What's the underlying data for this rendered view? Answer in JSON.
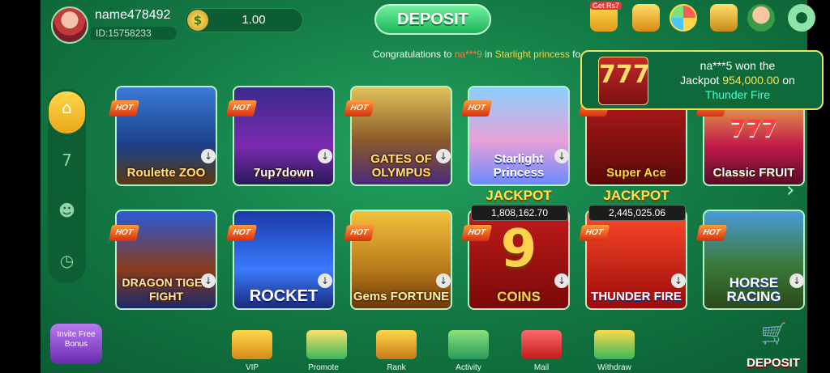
{
  "user": {
    "name": "name478492",
    "id": "ID:15758233",
    "balance": "1.00",
    "currency_symbol": "$"
  },
  "header": {
    "deposit_label": "DEPOSIT",
    "get_rs_label": "Get Rs7",
    "icons": [
      "gift-bag-icon",
      "gift-box-icon",
      "spin-wheel-icon",
      "party-icon",
      "support-agent-icon",
      "settings-gear-icon"
    ]
  },
  "marquee": {
    "prefix": "Congratulations to ",
    "user": "na***9",
    "mid": " in ",
    "game": "Starlight princess",
    "suffix": " fo"
  },
  "popup": {
    "line1": "na***5 won the",
    "line2_pre": "Jackpot ",
    "amount": "954,000.00",
    "line2_post": " on",
    "game": "Thunder Fire",
    "thumb_text": "777"
  },
  "sidebar": {
    "items": [
      "home-icon",
      "slots-777-icon",
      "people-icon",
      "history-icon"
    ]
  },
  "games": [
    {
      "title": "Roulette ZOO",
      "hot": "HOT"
    },
    {
      "title": "7up7down",
      "hot": "HOT"
    },
    {
      "title": "GATES OF OLYMPUS",
      "hot": "HOT"
    },
    {
      "title": "Starlight Princess",
      "hot": "HOT"
    },
    {
      "title": "Super Ace",
      "hot": "HOT"
    },
    {
      "title": "Classic FRUIT",
      "hot": "HOT",
      "decor": "777"
    },
    {
      "title": "DRAGON TIGER FIGHT",
      "hot": "HOT"
    },
    {
      "title": "ROCKET",
      "hot": "HOT"
    },
    {
      "title": "Gems FORTUNE",
      "hot": "HOT"
    },
    {
      "title": "COINS",
      "hot": "HOT",
      "jackpot_label": "JACKPOT",
      "jackpot": "1,808,162.70",
      "big": "9"
    },
    {
      "title": "THUNDER FIRE",
      "hot": "HOT",
      "jackpot_label": "JACKPOT",
      "jackpot": "2,445,025.06"
    },
    {
      "title": "HORSE RACING",
      "hot": "HOT"
    }
  ],
  "bottom_nav": {
    "invite": "Invite Free Bonus",
    "items": [
      "VIP",
      "Promote",
      "Rank",
      "Activity",
      "Mail",
      "Withdraw"
    ],
    "deposit": "DEPOSIT"
  },
  "colors": {
    "bg": "#147d46",
    "accent_green": "#1fb45a",
    "gold": "#ffd84a",
    "popup_border": "#f0e25a"
  }
}
